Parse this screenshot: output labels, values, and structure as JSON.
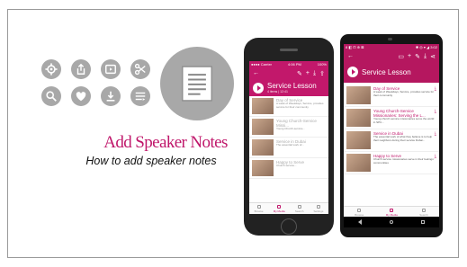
{
  "slide": {
    "title": "Add Speaker Notes",
    "subtitle": "How to add speaker notes"
  },
  "feature_icons": [
    {
      "name": "gear-icon"
    },
    {
      "name": "share-icon"
    },
    {
      "name": "video-icon"
    },
    {
      "name": "scissors-icon"
    },
    {
      "name": "search-icon"
    },
    {
      "name": "heart-icon"
    },
    {
      "name": "download-icon"
    },
    {
      "name": "list-icon"
    }
  ],
  "featured_icon": "notes-document-icon",
  "colors": {
    "accent": "#c0176b",
    "icon_gray": "#a8a8a8",
    "iphone_header": "#c2186b",
    "android_header": "#b5175f"
  },
  "iphone": {
    "status_left": "●●●● Carrier",
    "status_time": "4:06 PM",
    "status_right": "100%",
    "header_title": "Service Lesson",
    "header_meta": "4 items | 12:41",
    "items": [
      {
        "title": "Day of Service",
        "desc": "A week of Weekdays, Service, provides service for their community"
      },
      {
        "title": "Young Church-Service Missi...",
        "desc": "Young Church-service..."
      },
      {
        "title": "Service in Dubai",
        "desc": "The essential work of..."
      },
      {
        "title": "Happy to Serve",
        "desc": "Church service..."
      }
    ],
    "tabs": [
      "Browse",
      "My Media",
      "Search",
      "Settings"
    ],
    "active_tab": 1
  },
  "android": {
    "status_left": "8 ◧ ⊡ ⊕ ⊠",
    "status_right": "✱ ◎ ▾ ◢ 3:02",
    "header_title": "Service Lesson",
    "items": [
      {
        "title": "Day of Service",
        "desc": "A week of Weekdays, Service, provides service for their community"
      },
      {
        "title": "Young Church-Service Missionaries: Serving the L...",
        "desc": "Young church service missionaries serve the world in SPC..."
      },
      {
        "title": "Service in Dubai",
        "desc": "The essential work of what they believe is to help their neighbors during their service Dubai..."
      },
      {
        "title": "Happy to Serve",
        "desc": "Church service missionaries serve in their feelings' communities"
      }
    ],
    "tabs": [
      "Browse",
      "My Media",
      "Search"
    ],
    "active_tab": 1
  }
}
